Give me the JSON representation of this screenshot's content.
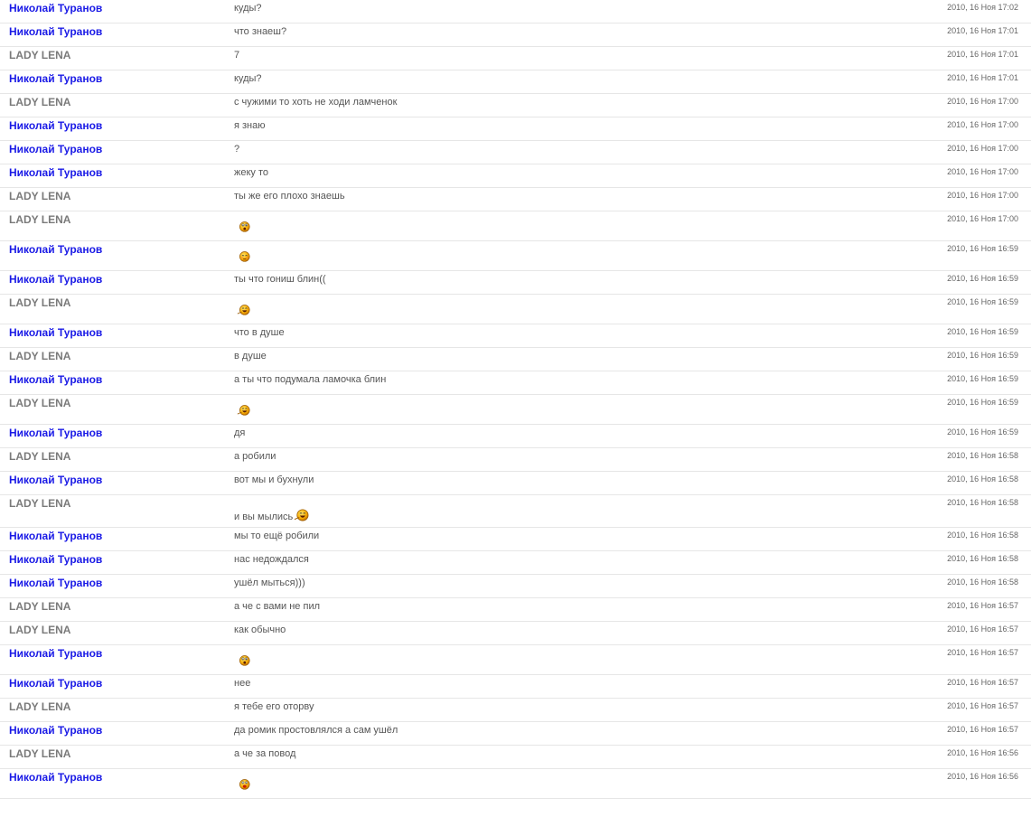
{
  "messages": [
    {
      "author": "Николай Туранов",
      "who": "nik",
      "text": "куды?",
      "time": "2010, 16 Ноя 17:02"
    },
    {
      "author": "Николай Туранов",
      "who": "nik",
      "text": "что знаеш?",
      "time": "2010, 16 Ноя 17:01"
    },
    {
      "author": "LADY LENA",
      "who": "lena",
      "text": "7",
      "time": "2010, 16 Ноя 17:01"
    },
    {
      "author": "Николай Туранов",
      "who": "nik",
      "text": "куды?",
      "time": "2010, 16 Ноя 17:01"
    },
    {
      "author": "LADY LENA",
      "who": "lena",
      "text": "с чужими то хоть не ходи ламченок",
      "time": "2010, 16 Ноя 17:00"
    },
    {
      "author": "Николай Туранов",
      "who": "nik",
      "text": "я знаю",
      "time": "2010, 16 Ноя 17:00"
    },
    {
      "author": "Николай Туранов",
      "who": "nik",
      "text": "?",
      "time": "2010, 16 Ноя 17:00"
    },
    {
      "author": "Николай Туранов",
      "who": "nik",
      "text": "жеку то",
      "time": "2010, 16 Ноя 17:00"
    },
    {
      "author": "LADY LENA",
      "who": "lena",
      "text": "ты же его плохо знаешь",
      "time": "2010, 16 Ноя 17:00"
    },
    {
      "author": "LADY LENA",
      "who": "lena",
      "text": "",
      "smiley": "surprised-smiley-icon",
      "time": "2010, 16 Ноя 17:00"
    },
    {
      "author": "Николай Туранов",
      "who": "nik",
      "text": "",
      "smiley": "blush-smiley-icon",
      "time": "2010, 16 Ноя 16:59"
    },
    {
      "author": "Николай Туранов",
      "who": "nik",
      "text": "ты что гониш блин((",
      "time": "2010, 16 Ноя 16:59"
    },
    {
      "author": "LADY LENA",
      "who": "lena",
      "text": "",
      "smiley": "laughing-smiley-icon",
      "time": "2010, 16 Ноя 16:59"
    },
    {
      "author": "Николай Туранов",
      "who": "nik",
      "text": "что в душе",
      "time": "2010, 16 Ноя 16:59"
    },
    {
      "author": "LADY LENA",
      "who": "lena",
      "text": "в душе",
      "time": "2010, 16 Ноя 16:59"
    },
    {
      "author": "Николай Туранов",
      "who": "nik",
      "text": "а ты что подумала ламочка блин",
      "time": "2010, 16 Ноя 16:59"
    },
    {
      "author": "LADY LENA",
      "who": "lena",
      "text": "",
      "smiley": "laughing-smiley-icon",
      "time": "2010, 16 Ноя 16:59"
    },
    {
      "author": "Николай Туранов",
      "who": "nik",
      "text": "дя",
      "time": "2010, 16 Ноя 16:59"
    },
    {
      "author": "LADY LENA",
      "who": "lena",
      "text": "а робили",
      "time": "2010, 16 Ноя 16:58"
    },
    {
      "author": "Николай Туранов",
      "who": "nik",
      "text": "вот мы и бухнули",
      "time": "2010, 16 Ноя 16:58"
    },
    {
      "author": "LADY LENA",
      "who": "lena",
      "text": "и вы мылись",
      "smiley_inline": "laughing-smiley-icon",
      "time": "2010, 16 Ноя 16:58"
    },
    {
      "author": "Николай Туранов",
      "who": "nik",
      "text": "мы то ещё робили",
      "time": "2010, 16 Ноя 16:58"
    },
    {
      "author": "Николай Туранов",
      "who": "nik",
      "text": "нас недождался",
      "time": "2010, 16 Ноя 16:58"
    },
    {
      "author": "Николай Туранов",
      "who": "nik",
      "text": "ушёл мыться)))",
      "time": "2010, 16 Ноя 16:58"
    },
    {
      "author": "LADY LENA",
      "who": "lena",
      "text": "а че с вами не пил",
      "time": "2010, 16 Ноя 16:57"
    },
    {
      "author": "LADY LENA",
      "who": "lena",
      "text": "как обычно",
      "time": "2010, 16 Ноя 16:57"
    },
    {
      "author": "Николай Туранов",
      "who": "nik",
      "text": "",
      "smiley": "surprised-smiley-icon",
      "time": "2010, 16 Ноя 16:57"
    },
    {
      "author": "Николай Туранов",
      "who": "nik",
      "text": "нее",
      "time": "2010, 16 Ноя 16:57"
    },
    {
      "author": "LADY LENA",
      "who": "lena",
      "text": "я тебе его оторву",
      "time": "2010, 16 Ноя 16:57"
    },
    {
      "author": "Николай Туранов",
      "who": "nik",
      "text": "да ромик простовлялся а сам ушёл",
      "time": "2010, 16 Ноя 16:57"
    },
    {
      "author": "LADY LENA",
      "who": "lena",
      "text": "а че за повод",
      "time": "2010, 16 Ноя 16:56"
    },
    {
      "author": "Николай Туранов",
      "who": "nik",
      "text": "",
      "smiley": "shocked-smiley-icon",
      "time": "2010, 16 Ноя 16:56"
    }
  ]
}
